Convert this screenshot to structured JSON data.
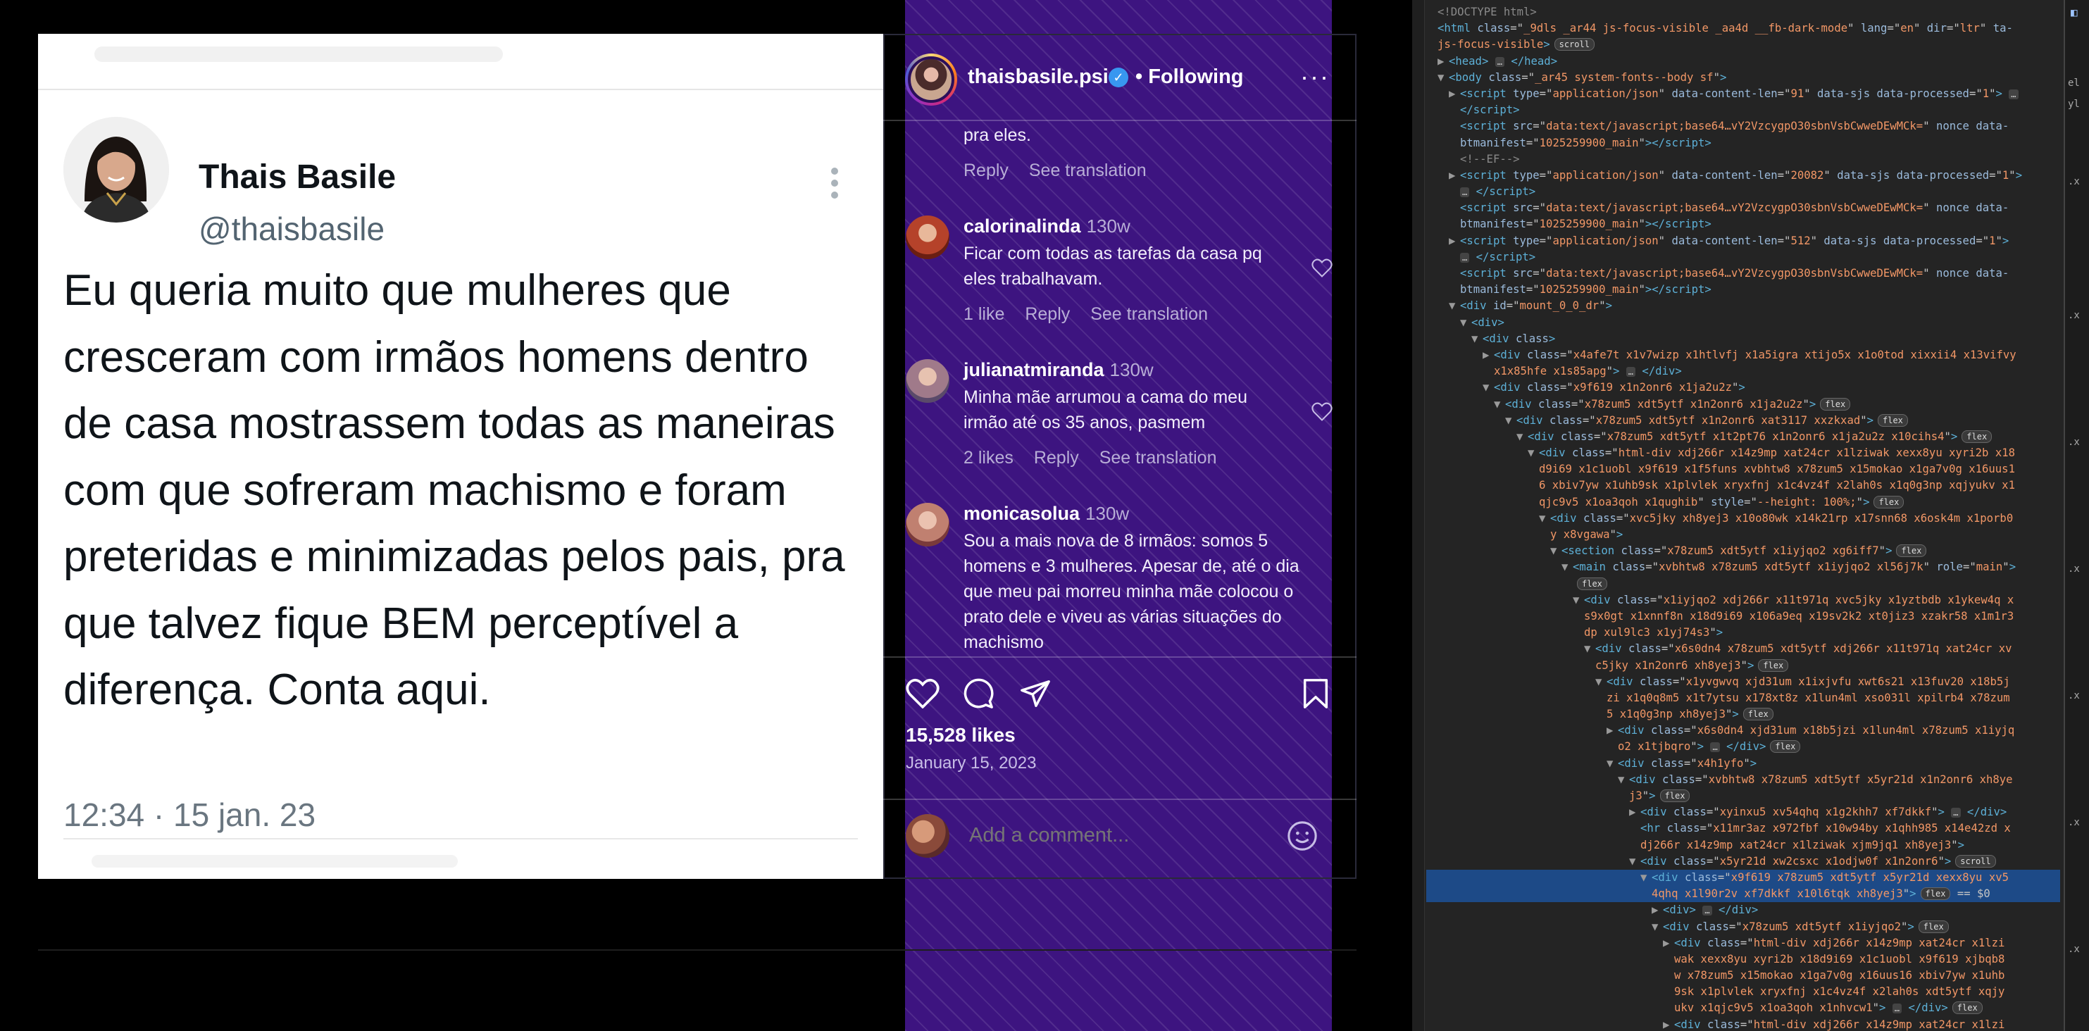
{
  "tweet": {
    "name": "Thais Basile",
    "handle": "@thaisbasile",
    "text": "Eu queria muito que mulheres que cresceram com irmãos homens dentro de casa mostrassem todas as maneiras com que sofreram machismo e foram preteridas e minimizadas pelos pais, pra que talvez fique BEM perceptível a diferença. Conta aqui.",
    "timestamp": "12:34 · 15 jan. 23"
  },
  "instagram": {
    "header": {
      "username": "thaisbasile.psi",
      "following_label": "Following",
      "more_label": "···"
    },
    "partial_comment": {
      "text": "pra eles.",
      "reply_label": "Reply",
      "translation_label": "See translation"
    },
    "comments": [
      {
        "username": "calorinalinda",
        "time": "130w",
        "text": "Ficar com todas as tarefas da casa pq eles trabalhavam.",
        "likes": "1 like",
        "reply_label": "Reply",
        "translation_label": "See translation"
      },
      {
        "username": "julianatmiranda",
        "time": "130w",
        "text": "Minha mãe arrumou a cama do meu irmão até os 35 anos, pasmem",
        "likes": "2 likes",
        "reply_label": "Reply",
        "translation_label": "See translation"
      },
      {
        "username": "monicasolua",
        "time": "130w",
        "text": "Sou a mais nova de 8 irmãos: somos 5 homens e 3 mulheres. Apesar de, até o dia que meu pai morreu minha mãe colocou o prato dele e viveu as várias situações do machismo"
      }
    ],
    "likes_count": "15,528 likes",
    "post_date": "January 15, 2023",
    "comment_placeholder": "Add a comment..."
  },
  "devtools": {
    "lines": [
      {
        "indent": 0,
        "arrow": "",
        "html": "<span class='cmt'>&lt;!DOCTYPE html&gt;</span>"
      },
      {
        "indent": 0,
        "arrow": "",
        "html": "<span class='tag'>&lt;html</span> <span class='atn'>class</span>=\"<span class='atv'>_9dls _ar44 js-focus-visible _aa4d __fb-dark-mode</span>\" <span class='atn'>lang</span>=\"<span class='atv'>en</span>\" <span class='atn'>dir</span>=\"<span class='atv'>ltr</span>\" <span class='atn'>ta-</span>"
      },
      {
        "indent": 0,
        "arrow": "",
        "html": "<span class='atv'>js-focus-visible</span><span class='tag'>&gt;</span><span class='badge'>scroll</span>"
      },
      {
        "indent": 1,
        "arrow": "▶",
        "html": "<span class='tag'>&lt;head&gt;</span> <span class='ell'>…</span> <span class='tag'>&lt;/head&gt;</span>"
      },
      {
        "indent": 1,
        "arrow": "▼",
        "html": "<span class='tag'>&lt;body</span> <span class='atn'>class</span>=\"<span class='atv'>_ar45 system-fonts--body sf</span>\"<span class='tag'>&gt;</span>"
      },
      {
        "indent": 2,
        "arrow": "▶",
        "html": "<span class='tag'>&lt;script</span> <span class='atn'>type</span>=\"<span class='atv'>application/json</span>\" <span class='atn'>data-content-len</span>=\"<span class='atv'>91</span>\" <span class='atn'>data-sjs data-processed</span>=\"<span class='atv'>1</span>\"<span class='tag'>&gt;</span> <span class='ell'>…</span>"
      },
      {
        "indent": 2,
        "arrow": "",
        "html": "<span class='tag'>&lt;/script&gt;</span>"
      },
      {
        "indent": 2,
        "arrow": "",
        "html": "<span class='tag'>&lt;script</span> <span class='atn'>src</span>=\"<span class='atv'>data:text/javascript;base64…vY2VzcygpO30sbnVsbCwweDEwMCk=</span>\" <span class='atn'>nonce data-</span>"
      },
      {
        "indent": 2,
        "arrow": "",
        "html": "<span class='atn'>btmanifest</span>=\"<span class='atv'>1025259900_main</span>\"<span class='tag'>&gt;&lt;/script&gt;</span>"
      },
      {
        "indent": 2,
        "arrow": "",
        "html": "<span class='cmt'>&lt;!--EF--&gt;</span>"
      },
      {
        "indent": 2,
        "arrow": "▶",
        "html": "<span class='tag'>&lt;script</span> <span class='atn'>type</span>=\"<span class='atv'>application/json</span>\" <span class='atn'>data-content-len</span>=\"<span class='atv'>20082</span>\" <span class='atn'>data-sjs data-processed</span>=\"<span class='atv'>1</span>\"<span class='tag'>&gt;</span>"
      },
      {
        "indent": 2,
        "arrow": "",
        "html": "<span class='ell'>…</span> <span class='tag'>&lt;/script&gt;</span>"
      },
      {
        "indent": 2,
        "arrow": "",
        "html": "<span class='tag'>&lt;script</span> <span class='atn'>src</span>=\"<span class='atv'>data:text/javascript;base64…vY2VzcygpO30sbnVsbCwweDEwMCk=</span>\" <span class='atn'>nonce data-</span>"
      },
      {
        "indent": 2,
        "arrow": "",
        "html": "<span class='atn'>btmanifest</span>=\"<span class='atv'>1025259900_main</span>\"<span class='tag'>&gt;&lt;/script&gt;</span>"
      },
      {
        "indent": 2,
        "arrow": "▶",
        "html": "<span class='tag'>&lt;script</span> <span class='atn'>type</span>=\"<span class='atv'>application/json</span>\" <span class='atn'>data-content-len</span>=\"<span class='atv'>512</span>\" <span class='atn'>data-sjs data-processed</span>=\"<span class='atv'>1</span>\"<span class='tag'>&gt;</span>"
      },
      {
        "indent": 2,
        "arrow": "",
        "html": "<span class='ell'>…</span> <span class='tag'>&lt;/script&gt;</span>"
      },
      {
        "indent": 2,
        "arrow": "",
        "html": "<span class='tag'>&lt;script</span> <span class='atn'>src</span>=\"<span class='atv'>data:text/javascript;base64…vY2VzcygpO30sbnVsbCwweDEwMCk=</span>\" <span class='atn'>nonce data-</span>"
      },
      {
        "indent": 2,
        "arrow": "",
        "html": "<span class='atn'>btmanifest</span>=\"<span class='atv'>1025259900_main</span>\"<span class='tag'>&gt;&lt;/script&gt;</span>"
      },
      {
        "indent": 2,
        "arrow": "▼",
        "html": "<span class='tag'>&lt;div</span> <span class='atn'>id</span>=\"<span class='atv'>mount_0_0_dr</span>\"<span class='tag'>&gt;</span>"
      },
      {
        "indent": 3,
        "arrow": "▼",
        "html": "<span class='tag'>&lt;div&gt;</span>"
      },
      {
        "indent": 4,
        "arrow": "▼",
        "html": "<span class='tag'>&lt;div</span> <span class='atn'>class</span><span class='tag'>&gt;</span>"
      },
      {
        "indent": 5,
        "arrow": "▶",
        "html": "<span class='tag'>&lt;div</span> <span class='atn'>class</span>=\"<span class='atv'>x4afe7t x1v7wizp x1htlvfj x1a5igra xtijo5x x1o0tod xixxii4 x13vifvy</span>"
      },
      {
        "indent": 5,
        "arrow": "",
        "html": "<span class='atv'>x1x85hfe x1s85apg</span>\"<span class='tag'>&gt;</span> <span class='ell'>…</span> <span class='tag'>&lt;/div&gt;</span>"
      },
      {
        "indent": 5,
        "arrow": "▼",
        "html": "<span class='tag'>&lt;div</span> <span class='atn'>class</span>=\"<span class='atv'>x9f619 x1n2onr6 x1ja2u2z</span>\"<span class='tag'>&gt;</span>"
      },
      {
        "indent": 6,
        "arrow": "▼",
        "html": "<span class='tag'>&lt;div</span> <span class='atn'>class</span>=\"<span class='atv'>x78zum5 xdt5ytf x1n2onr6 x1ja2u2z</span>\"<span class='tag'>&gt;</span><span class='badge'>flex</span>"
      },
      {
        "indent": 7,
        "arrow": "▼",
        "html": "<span class='tag'>&lt;div</span> <span class='atn'>class</span>=\"<span class='atv'>x78zum5 xdt5ytf x1n2onr6 xat3117 xxzkxad</span>\"<span class='tag'>&gt;</span><span class='badge'>flex</span>"
      },
      {
        "indent": 8,
        "arrow": "▼",
        "html": "<span class='tag'>&lt;div</span> <span class='atn'>class</span>=\"<span class='atv'>x78zum5 xdt5ytf x1t2pt76 x1n2onr6 x1ja2u2z x10cihs4</span>\"<span class='tag'>&gt;</span><span class='badge'>flex</span>"
      },
      {
        "indent": 9,
        "arrow": "▼",
        "html": "<span class='tag'>&lt;div</span> <span class='atn'>class</span>=\"<span class='atv'>html-div xdj266r x14z9mp xat24cr x1lziwak xexx8yu xyri2b x18</span>"
      },
      {
        "indent": 9,
        "arrow": "",
        "html": "<span class='atv'>d9i69 x1c1uobl x9f619 x1f5funs xvbhtw8 x78zum5 x15mokao x1ga7v0g x16uus1</span>"
      },
      {
        "indent": 9,
        "arrow": "",
        "html": "<span class='atv'>6 xbiv7yw x1uhb9sk x1plvlek xryxfnj x1c4vz4f x2lah0s x1q0g3np xqjyukv x1</span>"
      },
      {
        "indent": 9,
        "arrow": "",
        "html": "<span class='atv'>qjc9v5 x1oa3qoh x1qughib</span>\" <span class='atn'>style</span>=\"<span class='atv'>--height: 100%;</span>\"<span class='tag'>&gt;</span><span class='badge'>flex</span>"
      },
      {
        "indent": 10,
        "arrow": "▼",
        "html": "<span class='tag'>&lt;div</span> <span class='atn'>class</span>=\"<span class='atv'>xvc5jky xh8yej3 x10o80wk x14k21rp x17snn68 x6osk4m x1porb0</span>"
      },
      {
        "indent": 10,
        "arrow": "",
        "html": "<span class='atv'>y x8vgawa</span>\"<span class='tag'>&gt;</span>"
      },
      {
        "indent": 11,
        "arrow": "▼",
        "html": "<span class='tag'>&lt;section</span> <span class='atn'>class</span>=\"<span class='atv'>x78zum5 xdt5ytf x1iyjqo2 xg6iff7</span>\"<span class='tag'>&gt;</span><span class='badge'>flex</span>"
      },
      {
        "indent": 12,
        "arrow": "▼",
        "html": "<span class='tag'>&lt;main</span> <span class='atn'>class</span>=\"<span class='atv'>xvbhtw8 x78zum5 xdt5ytf x1iyjqo2 xl56j7k</span>\" <span class='atn'>role</span>=\"<span class='atv'>main</span>\"<span class='tag'>&gt;</span>"
      },
      {
        "indent": 12,
        "arrow": "",
        "html": "<span class='badge'>flex</span>"
      },
      {
        "indent": 13,
        "arrow": "▼",
        "html": "<span class='tag'>&lt;div</span> <span class='atn'>class</span>=\"<span class='atv'>x1iyjqo2 xdj266r x11t971q xvc5jky x1yztbdb x1ykew4q x</span>"
      },
      {
        "indent": 13,
        "arrow": "",
        "html": "<span class='atv'>s9x0gt x1xnnf8n x18d9i69 x106a9eq x19sv2k2 xt0jiz3 xzakr58 x1m1r3</span>"
      },
      {
        "indent": 13,
        "arrow": "",
        "html": "<span class='atv'>dp xul9lc3 x1yj74s3</span>\"<span class='tag'>&gt;</span>"
      },
      {
        "indent": 14,
        "arrow": "▼",
        "html": "<span class='tag'>&lt;div</span> <span class='atn'>class</span>=\"<span class='atv'>x6s0dn4 x78zum5 xdt5ytf xdj266r x11t971q xat24cr xv</span>"
      },
      {
        "indent": 14,
        "arrow": "",
        "html": "<span class='atv'>c5jky x1n2onr6 xh8yej3</span>\"<span class='tag'>&gt;</span><span class='badge'>flex</span>"
      },
      {
        "indent": 15,
        "arrow": "▼",
        "html": "<span class='tag'>&lt;div</span> <span class='atn'>class</span>=\"<span class='atv'>x1yvgwvq xjd31um x1ixjvfu xwt6s21 x13fuv20 x18b5j</span>"
      },
      {
        "indent": 15,
        "arrow": "",
        "html": "<span class='atv'>zi x1q0q8m5 x1t7ytsu x178xt8z x1lun4ml xso031l xpilrb4 x78zum</span>"
      },
      {
        "indent": 15,
        "arrow": "",
        "html": "<span class='atv'>5 x1q0g3np xh8yej3</span>\"<span class='tag'>&gt;</span><span class='badge'>flex</span>"
      },
      {
        "indent": 16,
        "arrow": "▶",
        "html": "<span class='tag'>&lt;div</span> <span class='atn'>class</span>=\"<span class='atv'>x6s0dn4 xjd31um x18b5jzi x1lun4ml x78zum5 x1iyjq</span>"
      },
      {
        "indent": 16,
        "arrow": "",
        "html": "<span class='atv'>o2 x1tjbqro</span>\"<span class='tag'>&gt;</span> <span class='ell'>…</span> <span class='tag'>&lt;/div&gt;</span><span class='badge'>flex</span>"
      },
      {
        "indent": 16,
        "arrow": "▼",
        "html": "<span class='tag'>&lt;div</span> <span class='atn'>class</span>=\"<span class='atv'>x4h1yfo</span>\"<span class='tag'>&gt;</span>"
      },
      {
        "indent": 17,
        "arrow": "▼",
        "html": "<span class='tag'>&lt;div</span> <span class='atn'>class</span>=\"<span class='atv'>xvbhtw8 x78zum5 xdt5ytf x5yr21d x1n2onr6 xh8ye</span>"
      },
      {
        "indent": 17,
        "arrow": "",
        "html": "<span class='atv'>j3</span>\"<span class='tag'>&gt;</span><span class='badge'>flex</span>"
      },
      {
        "indent": 18,
        "arrow": "▶",
        "html": "<span class='tag'>&lt;div</span> <span class='atn'>class</span>=\"<span class='atv'>xyinxu5 xv54qhq x1g2khh7 xf7dkkf</span>\"<span class='tag'>&gt;</span> <span class='ell'>…</span> <span class='tag'>&lt;/div&gt;</span>"
      },
      {
        "indent": 18,
        "arrow": "",
        "html": "<span class='tag'>&lt;hr</span> <span class='atn'>class</span>=\"<span class='atv'>x11mr3az x972fbf x10w94by x1qhh985 x14e42zd x</span>"
      },
      {
        "indent": 18,
        "arrow": "",
        "html": "<span class='atv'>dj266r x14z9mp xat24cr x1lziwak xjm9jq1 xh8yej3</span>\"<span class='tag'>&gt;</span>"
      },
      {
        "indent": 18,
        "arrow": "▼",
        "html": "<span class='tag'>&lt;div</span> <span class='atn'>class</span>=\"<span class='atv'>x5yr21d xw2csxc x1odjw0f x1n2onr6</span>\"<span class='tag'>&gt;</span><span class='badge'>scroll</span>"
      },
      {
        "indent": 19,
        "arrow": "▼",
        "sel": true,
        "html": "<span class='tag'>&lt;div</span> <span class='atn'>class</span>=\"<span class='atv'>x9f619 x78zum5 xdt5ytf x5yr21d xexx8yu xv5</span>"
      },
      {
        "indent": 19,
        "arrow": "",
        "sel": true,
        "html": "<span class='atv'>4qhq x1l90r2v xf7dkkf x10l6tqk xh8yej3</span>\"<span class='tag'>&gt;</span><span class='badge'>flex</span> == $0"
      },
      {
        "indent": 20,
        "arrow": "▶",
        "html": "<span class='tag'>&lt;div&gt;</span> <span class='ell'>…</span> <span class='tag'>&lt;/div&gt;</span>"
      },
      {
        "indent": 20,
        "arrow": "▼",
        "html": "<span class='tag'>&lt;div</span> <span class='atn'>class</span>=\"<span class='atv'>x78zum5 xdt5ytf x1iyjqo2</span>\"<span class='tag'>&gt;</span><span class='badge'>flex</span>"
      },
      {
        "indent": 21,
        "arrow": "▶",
        "html": "<span class='tag'>&lt;div</span> <span class='atn'>class</span>=\"<span class='atv'>html-div xdj266r x14z9mp xat24cr x1lzi</span>"
      },
      {
        "indent": 21,
        "arrow": "",
        "html": "<span class='atv'>wak xexx8yu xyri2b x18d9i69 x1c1uobl x9f619 xjbqb8</span>"
      },
      {
        "indent": 21,
        "arrow": "",
        "html": "<span class='atv'>w x78zum5 x15mokao x1ga7v0g x16uus16 xbiv7yw x1uhb</span>"
      },
      {
        "indent": 21,
        "arrow": "",
        "html": "<span class='atv'>9sk x1plvlek xryxfnj x1c4vz4f x2lah0s xdt5ytf xqjy</span>"
      },
      {
        "indent": 21,
        "arrow": "",
        "html": "<span class='atv'>ukv x1qjc9v5 x1oa3qoh x1nhvcw1</span>\"<span class='tag'>&gt;</span> <span class='ell'>…</span> <span class='tag'>&lt;/div&gt;</span><span class='badge'>flex</span>"
      },
      {
        "indent": 21,
        "arrow": "▶",
        "html": "<span class='tag'>&lt;div</span> <span class='atn'>class</span>=\"<span class='atv'>html-div xdj266r x14z9mp xat24cr x1lzi</span>"
      }
    ]
  }
}
